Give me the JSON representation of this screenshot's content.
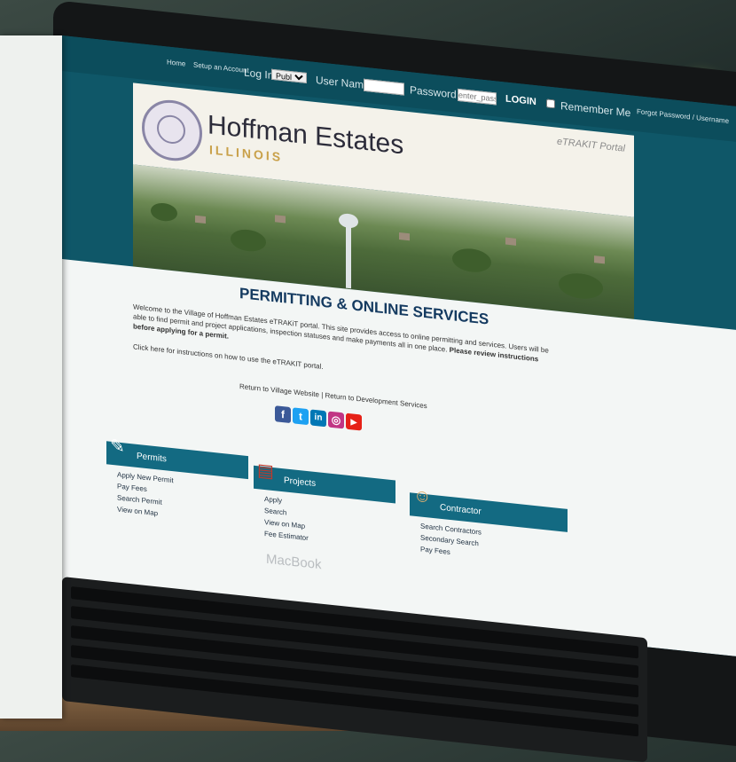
{
  "topbar": {
    "home": "Home",
    "setup_account": "Setup an Account",
    "login_label": "Log In",
    "login_type": "Public",
    "username_label": "User Name",
    "password_label": "Password",
    "password_placeholder": "enter_password",
    "login_button": "LOGIN",
    "remember_me": "Remember Me",
    "forgot": "Forgot Password / Username"
  },
  "header": {
    "title": "Hoffman Estates",
    "subtitle": "ILLINOIS",
    "portal": "eTRAKIT Portal"
  },
  "main": {
    "heading": "PERMITTING & ONLINE SERVICES",
    "intro": "Welcome to the Village of Hoffman Estates eTRAKiT portal. This site provides access to online permitting and services. Users will be able to find permit and project applications, inspection statuses and make payments all in one place.",
    "intro_bold": "Please review instructions before applying for a permit.",
    "instructions_link": "Click here for instructions on how to use the eTRAKIT portal.",
    "return_link": "Return to Village Website | Return to Development Services"
  },
  "social": [
    {
      "name": "facebook-icon",
      "glyph": "f",
      "color": "#3b5998"
    },
    {
      "name": "twitter-icon",
      "glyph": "t",
      "color": "#1da1f2"
    },
    {
      "name": "linkedin-icon",
      "glyph": "in",
      "color": "#0077b5"
    },
    {
      "name": "instagram-icon",
      "glyph": "◎",
      "color": "#c13584"
    },
    {
      "name": "youtube-icon",
      "glyph": "▶",
      "color": "#e62117"
    }
  ],
  "panels": [
    {
      "title": "Permits",
      "icon": "✎",
      "items": [
        "Apply New Permit",
        "Pay Fees",
        "Search Permit",
        "View on Map"
      ]
    },
    {
      "title": "Projects",
      "icon": "▤",
      "items": [
        "Apply",
        "Search",
        "View on Map",
        "Fee Estimator"
      ]
    },
    {
      "title": "Contractor",
      "icon": "☺",
      "items": [
        "Search Contractors",
        "Secondary Search",
        "Pay Fees"
      ]
    }
  ],
  "brand": "MacBook"
}
